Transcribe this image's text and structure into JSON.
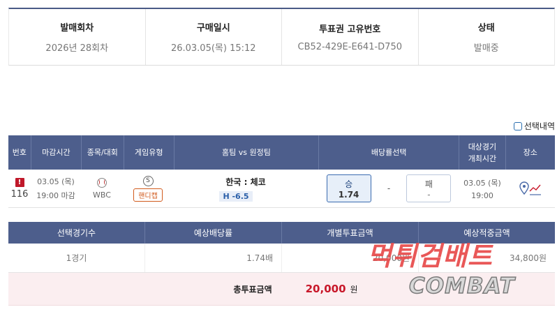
{
  "info": {
    "round_label": "발매회차",
    "round_value": "2026년 28회차",
    "purchase_label": "구매일시",
    "purchase_value": "26.03.05(목) 15:12",
    "ticket_label": "투표권 고유번호",
    "ticket_value": "CB52-429E-E641-D750",
    "status_label": "상태",
    "status_value": "발매중"
  },
  "select_history_label": "선택내역",
  "game_table": {
    "headers": [
      "번호",
      "마감시간",
      "종목/대회",
      "게임유형",
      "홈팀 vs 원정팀",
      "배당률선택",
      "대상경기\n개최시간",
      "장소"
    ],
    "rows": [
      {
        "alert_icon": "!",
        "number": "116",
        "close_date": "03.05 (목)",
        "close_time": "19:00 마감",
        "sport_icon": "baseball-icon",
        "league": "WBC",
        "type_icon": "S",
        "type_badge": "핸디캡",
        "teams": "한국 : 체코",
        "handicap": "H -6.5",
        "win_label": "승",
        "win_odds": "1.74",
        "draw_value": "-",
        "lose_label": "패",
        "lose_odds": "-",
        "game_date": "03.05 (목)",
        "game_time": "19:00",
        "place_icon": "map-marker-trend-icon"
      }
    ]
  },
  "summary": {
    "headers": [
      "선택경기수",
      "예상배당률",
      "개별투표금액",
      "예상적중금액"
    ],
    "games": "1경기",
    "odds": "1.74배",
    "bet_amount": "20,000원",
    "expected_win": "34,800원",
    "total_label": "총투표금액",
    "total_value": "20,000",
    "total_unit": "원"
  },
  "watermark": {
    "korean": "먹튀검배트",
    "english": "COMBAT"
  },
  "colors": {
    "header_bg": "#4d5e8c",
    "accent_red": "#c8182a",
    "handicap_orange": "#d15a1c",
    "selected_odds_bg": "#e7eff9",
    "total_bg": "#fbeef0"
  }
}
